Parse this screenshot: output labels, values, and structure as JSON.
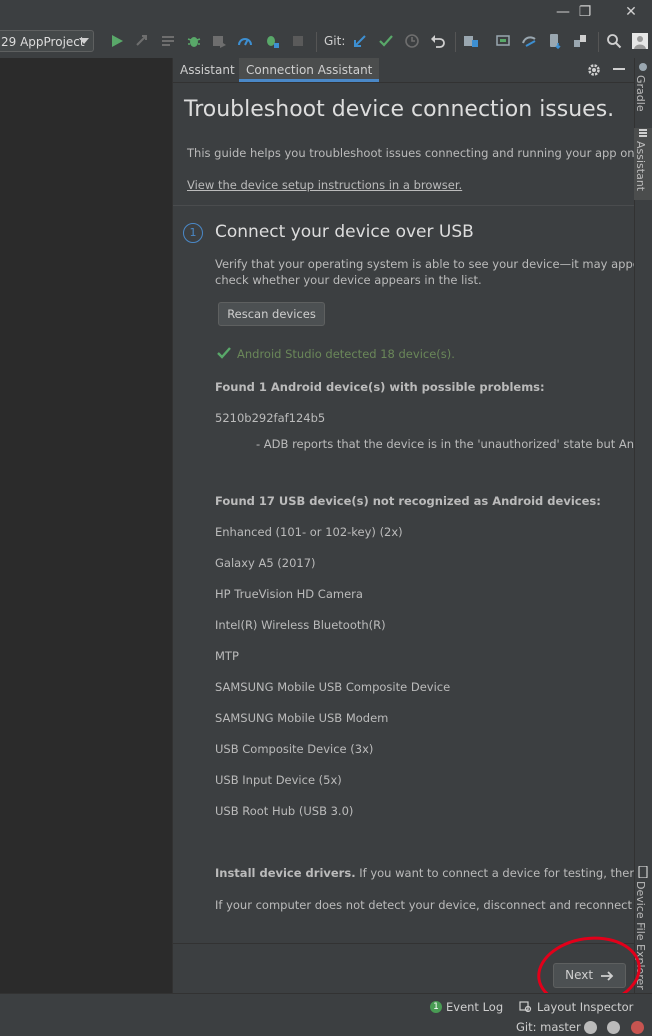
{
  "toolbar": {
    "run_config": "29 AppProject",
    "git_label": "Git:"
  },
  "assistant": {
    "tabs": [
      "Assistant",
      "Connection Assistant"
    ],
    "title": "Troubleshoot device connection issues.",
    "intro": "This guide helps you troubleshoot issues connecting and running your app on a phys",
    "setup_link": "View the device setup instructions in a browser.",
    "step": {
      "number": "1",
      "title": "Connect your device over USB",
      "desc_line1": "Verify that your operating system is able to see your device—it may appear as a",
      "desc_line2": "check whether your device appears in the list.",
      "rescan_label": "Rescan devices",
      "detected": "Android Studio detected 18 device(s).",
      "problem_heading": "Found 1 Android device(s) with possible problems:",
      "problem_device": "5210b292faf124b5",
      "problem_detail": "- ADB reports that the device is in the 'unauthorized' state but Android S",
      "usb_heading": "Found 17 USB device(s) not recognized as Android devices:",
      "usb_devices": [
        "Enhanced (101- or 102-key) (2x)",
        "Galaxy A5 (2017)",
        "HP TrueVision HD Camera",
        "Intel(R) Wireless Bluetooth(R)",
        "MTP",
        "SAMSUNG Mobile USB Composite Device",
        "SAMSUNG Mobile USB Modem",
        "USB Composite Device (3x)",
        "USB Input Device (5x)",
        "USB Root Hub (USB 3.0)"
      ],
      "drivers_bold": "Install device drivers.",
      "drivers_text": " If you want to connect a device for testing, then you nee",
      "reconnect_text": "If your computer does not detect your device, disconnect and reconnect your d"
    },
    "next_label": "Next"
  },
  "side_tabs": {
    "gradle": "Gradle",
    "assistant": "Assistant",
    "device_file_explorer": "Device File Explorer"
  },
  "statusbar": {
    "event_log_count": "1",
    "event_log": "Event Log",
    "layout_inspector": "Layout Inspector",
    "git_branch": "Git: master"
  },
  "colors": {
    "accent": "#4a88c7",
    "success": "#6a8759",
    "annotation": "#e2001a"
  }
}
